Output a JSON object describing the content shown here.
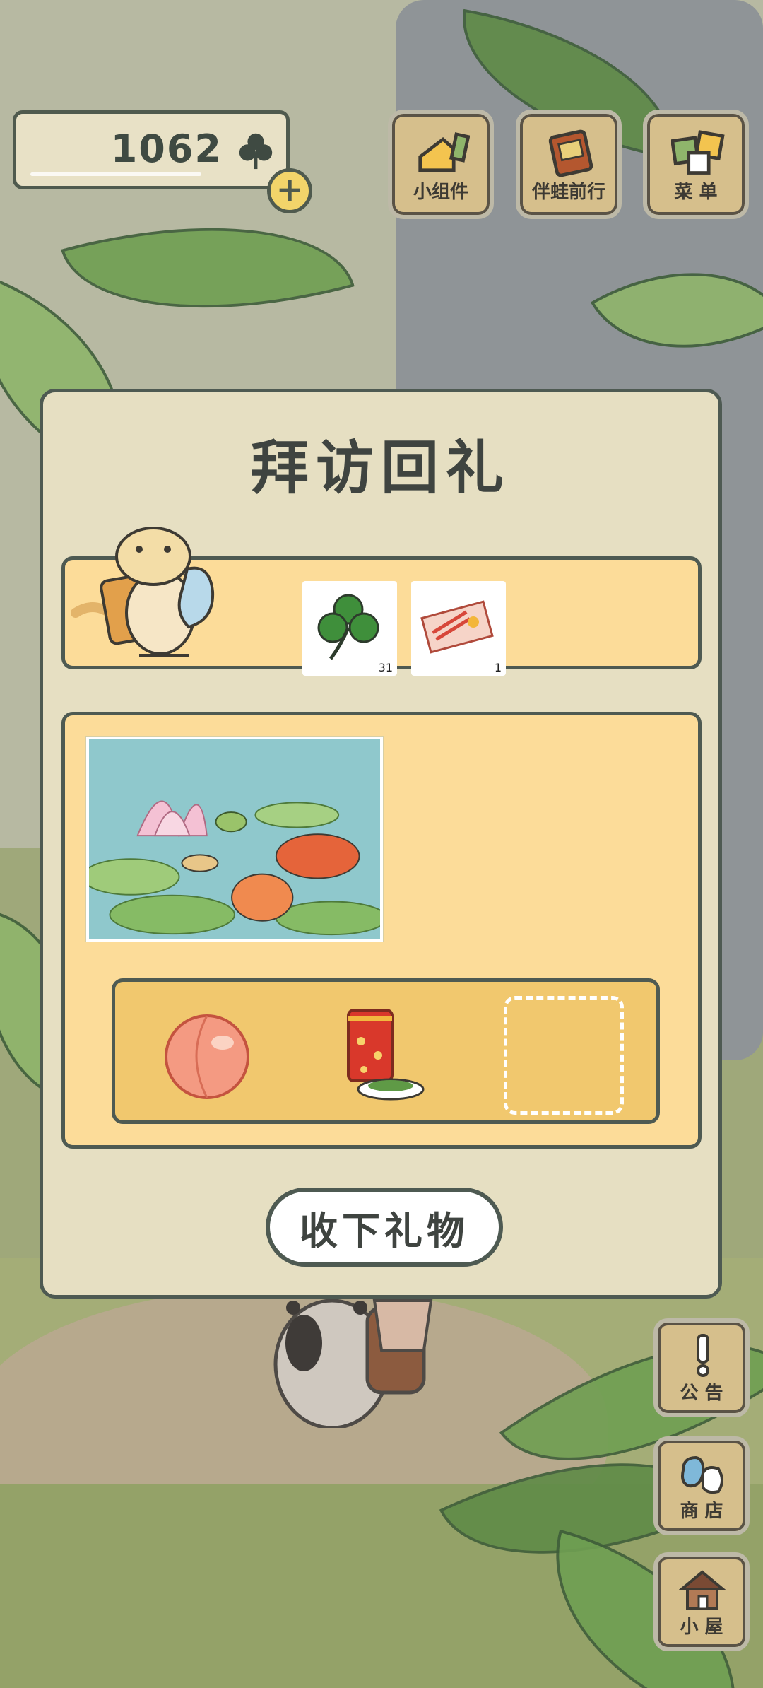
{
  "hud": {
    "clover_count": "1062",
    "add_button": "+"
  },
  "top_menu": [
    {
      "label": "小组件",
      "icon": "widget-icon"
    },
    {
      "label": "伴蛙前行",
      "icon": "journal-icon"
    },
    {
      "label": "菜 单",
      "icon": "menu-cards-icon"
    }
  ],
  "dialog": {
    "title": "拜访回礼",
    "rewards": [
      {
        "name": "clover",
        "icon": "clover-icon",
        "quantity": "31"
      },
      {
        "name": "ticket",
        "icon": "ticket-icon",
        "quantity": "1"
      }
    ],
    "foods": [
      {
        "name": "peach",
        "icon": "peach-icon"
      },
      {
        "name": "tea-can-and-greens",
        "icon": "tea-can-icon"
      }
    ],
    "accept_button": "收下礼物"
  },
  "side_menu": [
    {
      "label": "公 告",
      "icon": "exclamation-icon"
    },
    {
      "label": "商 店",
      "icon": "shop-bags-icon"
    },
    {
      "label": "小 屋",
      "icon": "house-icon"
    }
  ],
  "colors": {
    "panel": "#e6dfc2",
    "card": "#fcdc99",
    "tray": "#f1c86e",
    "outline": "#4e5a52",
    "button_wood": "#d6bf8c"
  }
}
